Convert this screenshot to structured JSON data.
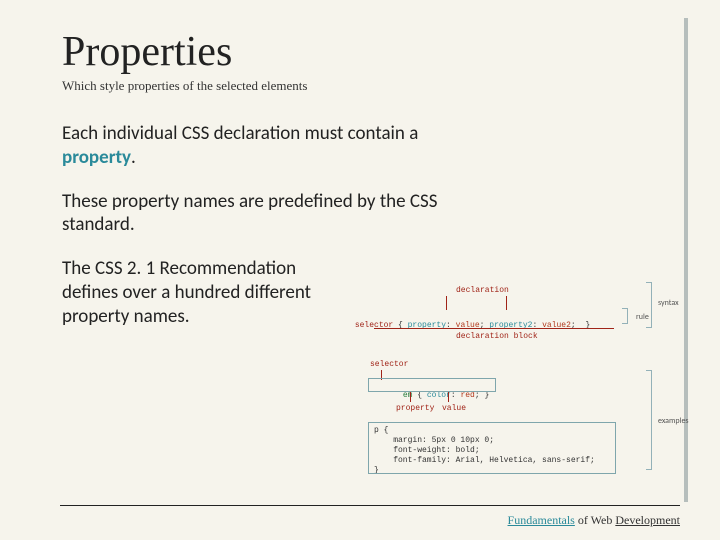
{
  "title": "Properties",
  "subtitle": "Which style properties of the selected elements",
  "paragraphs": {
    "p1a": "Each individual CSS declaration must contain a ",
    "p1b_accent": "property",
    "p1c": ".",
    "p2": "These property names are predefined by the CSS standard.",
    "p3": "The CSS 2. 1 Recommendation defines over a hundred different property names."
  },
  "diagram": {
    "labels": {
      "declaration": "declaration",
      "selector_left": "selector",
      "declaration_block": "declaration block",
      "selector_small": "selector",
      "property_small": "property",
      "value_small": "value",
      "syntax": "syntax",
      "rule": "rule",
      "examples": "examples"
    },
    "syntax_code": {
      "selector_token": "selector",
      "brace_open": " { ",
      "prop1": "property",
      "colon": ": ",
      "val1": "value",
      "semi": "; ",
      "prop2": "property2",
      "val2": "value2",
      "brace_close": " }"
    },
    "example1": {
      "sel": "em",
      "open": " { ",
      "prop": "color",
      "colon": ": ",
      "val": "red",
      "close": "; }"
    },
    "example2": {
      "sel": "p {",
      "l1": "    margin: 5px 0 10px 0;",
      "l2": "    font-weight: bold;",
      "l3": "    font-family: Arial, Helvetica, sans-serif;",
      "close": "}"
    }
  },
  "footer": {
    "fundamentals": "Fundamentals",
    "of": " of Web ",
    "development": "Development"
  }
}
